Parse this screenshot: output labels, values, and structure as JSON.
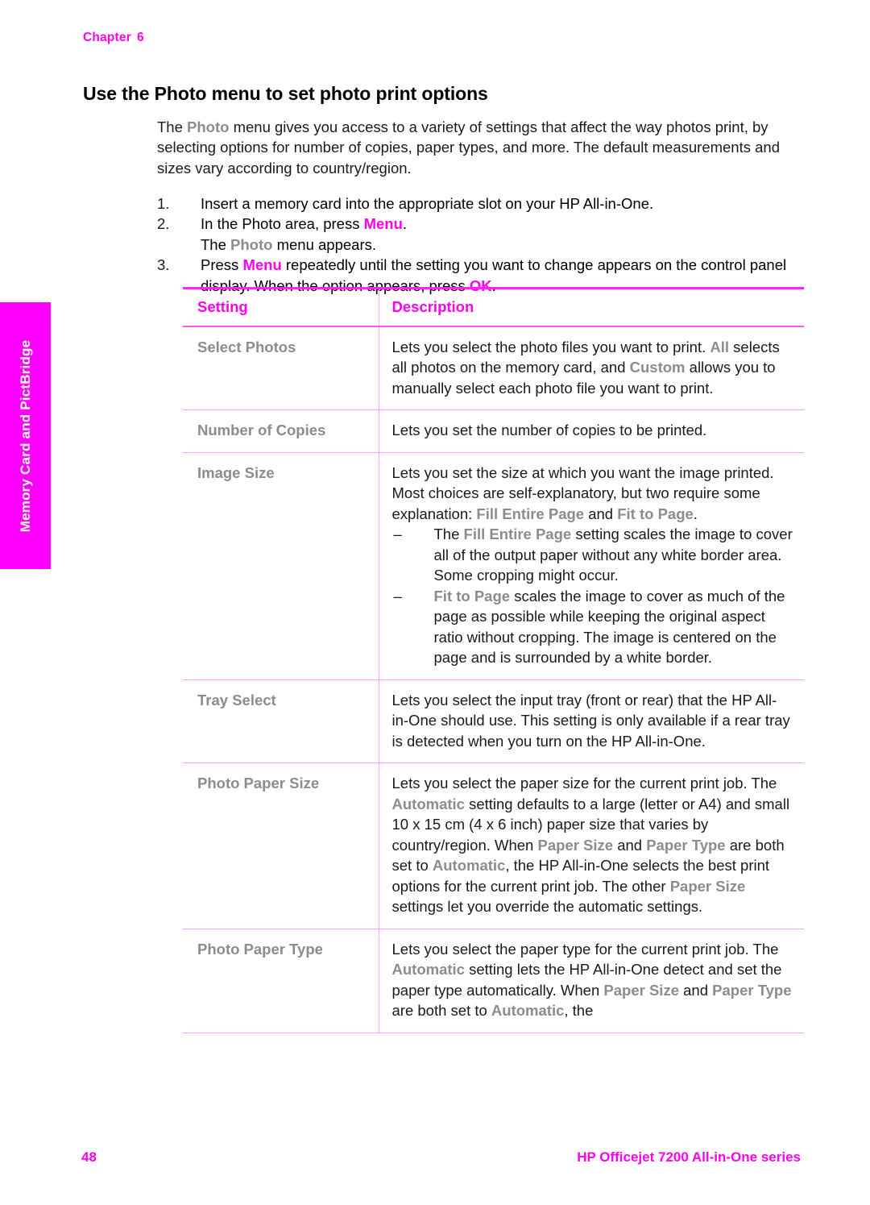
{
  "header": {
    "chapter_label": "Chapter",
    "chapter_number": "6"
  },
  "side_tab": {
    "label": "Memory Card and PictBridge",
    "background_color": "#ff00ff",
    "text_color": "#ffffff"
  },
  "title": "Use the Photo menu to set photo print options",
  "intro": {
    "part1": "The ",
    "ui1": "Photo",
    "part2": " menu gives you access to a variety of settings that affect the way photos print, by selecting options for number of copies, paper types, and more. The default measurements and sizes vary according to country/region."
  },
  "steps": [
    {
      "marker": "1.",
      "segments": [
        {
          "text": "Insert a memory card into the appropriate slot on your HP All-in-One.",
          "style": "plain"
        }
      ]
    },
    {
      "marker": "2.",
      "segments": [
        {
          "text": "In the Photo area, press ",
          "style": "plain"
        },
        {
          "text": "Menu",
          "style": "magenta"
        },
        {
          "text": ".",
          "style": "plain"
        }
      ],
      "substep": [
        {
          "text": "The ",
          "style": "plain"
        },
        {
          "text": "Photo",
          "style": "gray"
        },
        {
          "text": " menu appears.",
          "style": "plain"
        }
      ]
    },
    {
      "marker": "3.",
      "segments": [
        {
          "text": "Press ",
          "style": "plain"
        },
        {
          "text": "Menu",
          "style": "magenta"
        },
        {
          "text": " repeatedly until the setting you want to change appears on the control panel display. When the option appears, press ",
          "style": "plain"
        },
        {
          "text": "OK",
          "style": "magenta"
        },
        {
          "text": ".",
          "style": "plain"
        }
      ]
    }
  ],
  "table": {
    "headers": {
      "setting": "Setting",
      "description": "Description"
    },
    "rows": [
      {
        "setting": "Select Photos",
        "description": [
          {
            "text": "Lets you select the photo files you want to print. ",
            "style": "plain"
          },
          {
            "text": "All",
            "style": "gray"
          },
          {
            "text": " selects all photos on the memory card, and ",
            "style": "plain"
          },
          {
            "text": "Custom",
            "style": "gray"
          },
          {
            "text": " allows you to manually select each photo file you want to print.",
            "style": "plain"
          }
        ]
      },
      {
        "setting": "Number of Copies",
        "description": [
          {
            "text": "Lets you set the number of copies to be printed.",
            "style": "plain"
          }
        ]
      },
      {
        "setting": "Image Size",
        "description": [
          {
            "text": "Lets you set the size at which you want the image printed. Most choices are self-explanatory, but two require some explanation: ",
            "style": "plain"
          },
          {
            "text": "Fill Entire Page",
            "style": "gray"
          },
          {
            "text": " and ",
            "style": "plain"
          },
          {
            "text": "Fit to Page",
            "style": "gray"
          },
          {
            "text": ".",
            "style": "plain"
          }
        ],
        "bullets": [
          {
            "dash": "–",
            "segments": [
              {
                "text": "The ",
                "style": "plain"
              },
              {
                "text": "Fill Entire Page",
                "style": "gray"
              },
              {
                "text": " setting scales the image to cover all of the output paper without any white border area. Some cropping might occur.",
                "style": "plain"
              }
            ]
          },
          {
            "dash": "–",
            "segments": [
              {
                "text": "Fit to Page",
                "style": "gray"
              },
              {
                "text": " scales the image to cover as much of the page as possible while keeping the original aspect ratio without cropping. The image is centered on the page and is surrounded by a white border.",
                "style": "plain"
              }
            ]
          }
        ]
      },
      {
        "setting": "Tray Select",
        "description": [
          {
            "text": "Lets you select the input tray (front or rear) that the HP All-in-One should use. This setting is only available if a rear tray is detected when you turn on the HP All-in-One.",
            "style": "plain"
          }
        ]
      },
      {
        "setting": "Photo Paper Size",
        "description": [
          {
            "text": "Lets you select the paper size for the current print job. The ",
            "style": "plain"
          },
          {
            "text": "Automatic",
            "style": "gray"
          },
          {
            "text": " setting defaults to a large (letter or A4) and small 10 x 15 cm (4 x 6 inch) paper size that varies by country/region. When ",
            "style": "plain"
          },
          {
            "text": "Paper Size",
            "style": "gray"
          },
          {
            "text": " and ",
            "style": "plain"
          },
          {
            "text": "Paper Type",
            "style": "gray"
          },
          {
            "text": " are both set to ",
            "style": "plain"
          },
          {
            "text": "Automatic",
            "style": "gray"
          },
          {
            "text": ", the HP All-in-One selects the best print options for the current print job. The other ",
            "style": "plain"
          },
          {
            "text": "Paper Size",
            "style": "gray"
          },
          {
            "text": " settings let you override the automatic settings.",
            "style": "plain"
          }
        ]
      },
      {
        "setting": "Photo Paper Type",
        "description": [
          {
            "text": "Lets you select the paper type for the current print job. The ",
            "style": "plain"
          },
          {
            "text": "Automatic",
            "style": "gray"
          },
          {
            "text": " setting lets the HP All-in-One detect and set the paper type automatically. When ",
            "style": "plain"
          },
          {
            "text": "Paper Size",
            "style": "gray"
          },
          {
            "text": " and ",
            "style": "plain"
          },
          {
            "text": "Paper Type",
            "style": "gray"
          },
          {
            "text": " are both set to ",
            "style": "plain"
          },
          {
            "text": "Automatic",
            "style": "gray"
          },
          {
            "text": ", the ",
            "style": "plain"
          }
        ]
      }
    ]
  },
  "footer": {
    "page_number": "48",
    "product": "HP Officejet 7200 All-in-One series"
  },
  "colors": {
    "magenta": "#ff00ee",
    "tab_magenta": "#ff00ff",
    "ui_gray": "#8c8c8c",
    "rule_light": "#ff9cf5",
    "body_text": "#1a1a1a"
  }
}
